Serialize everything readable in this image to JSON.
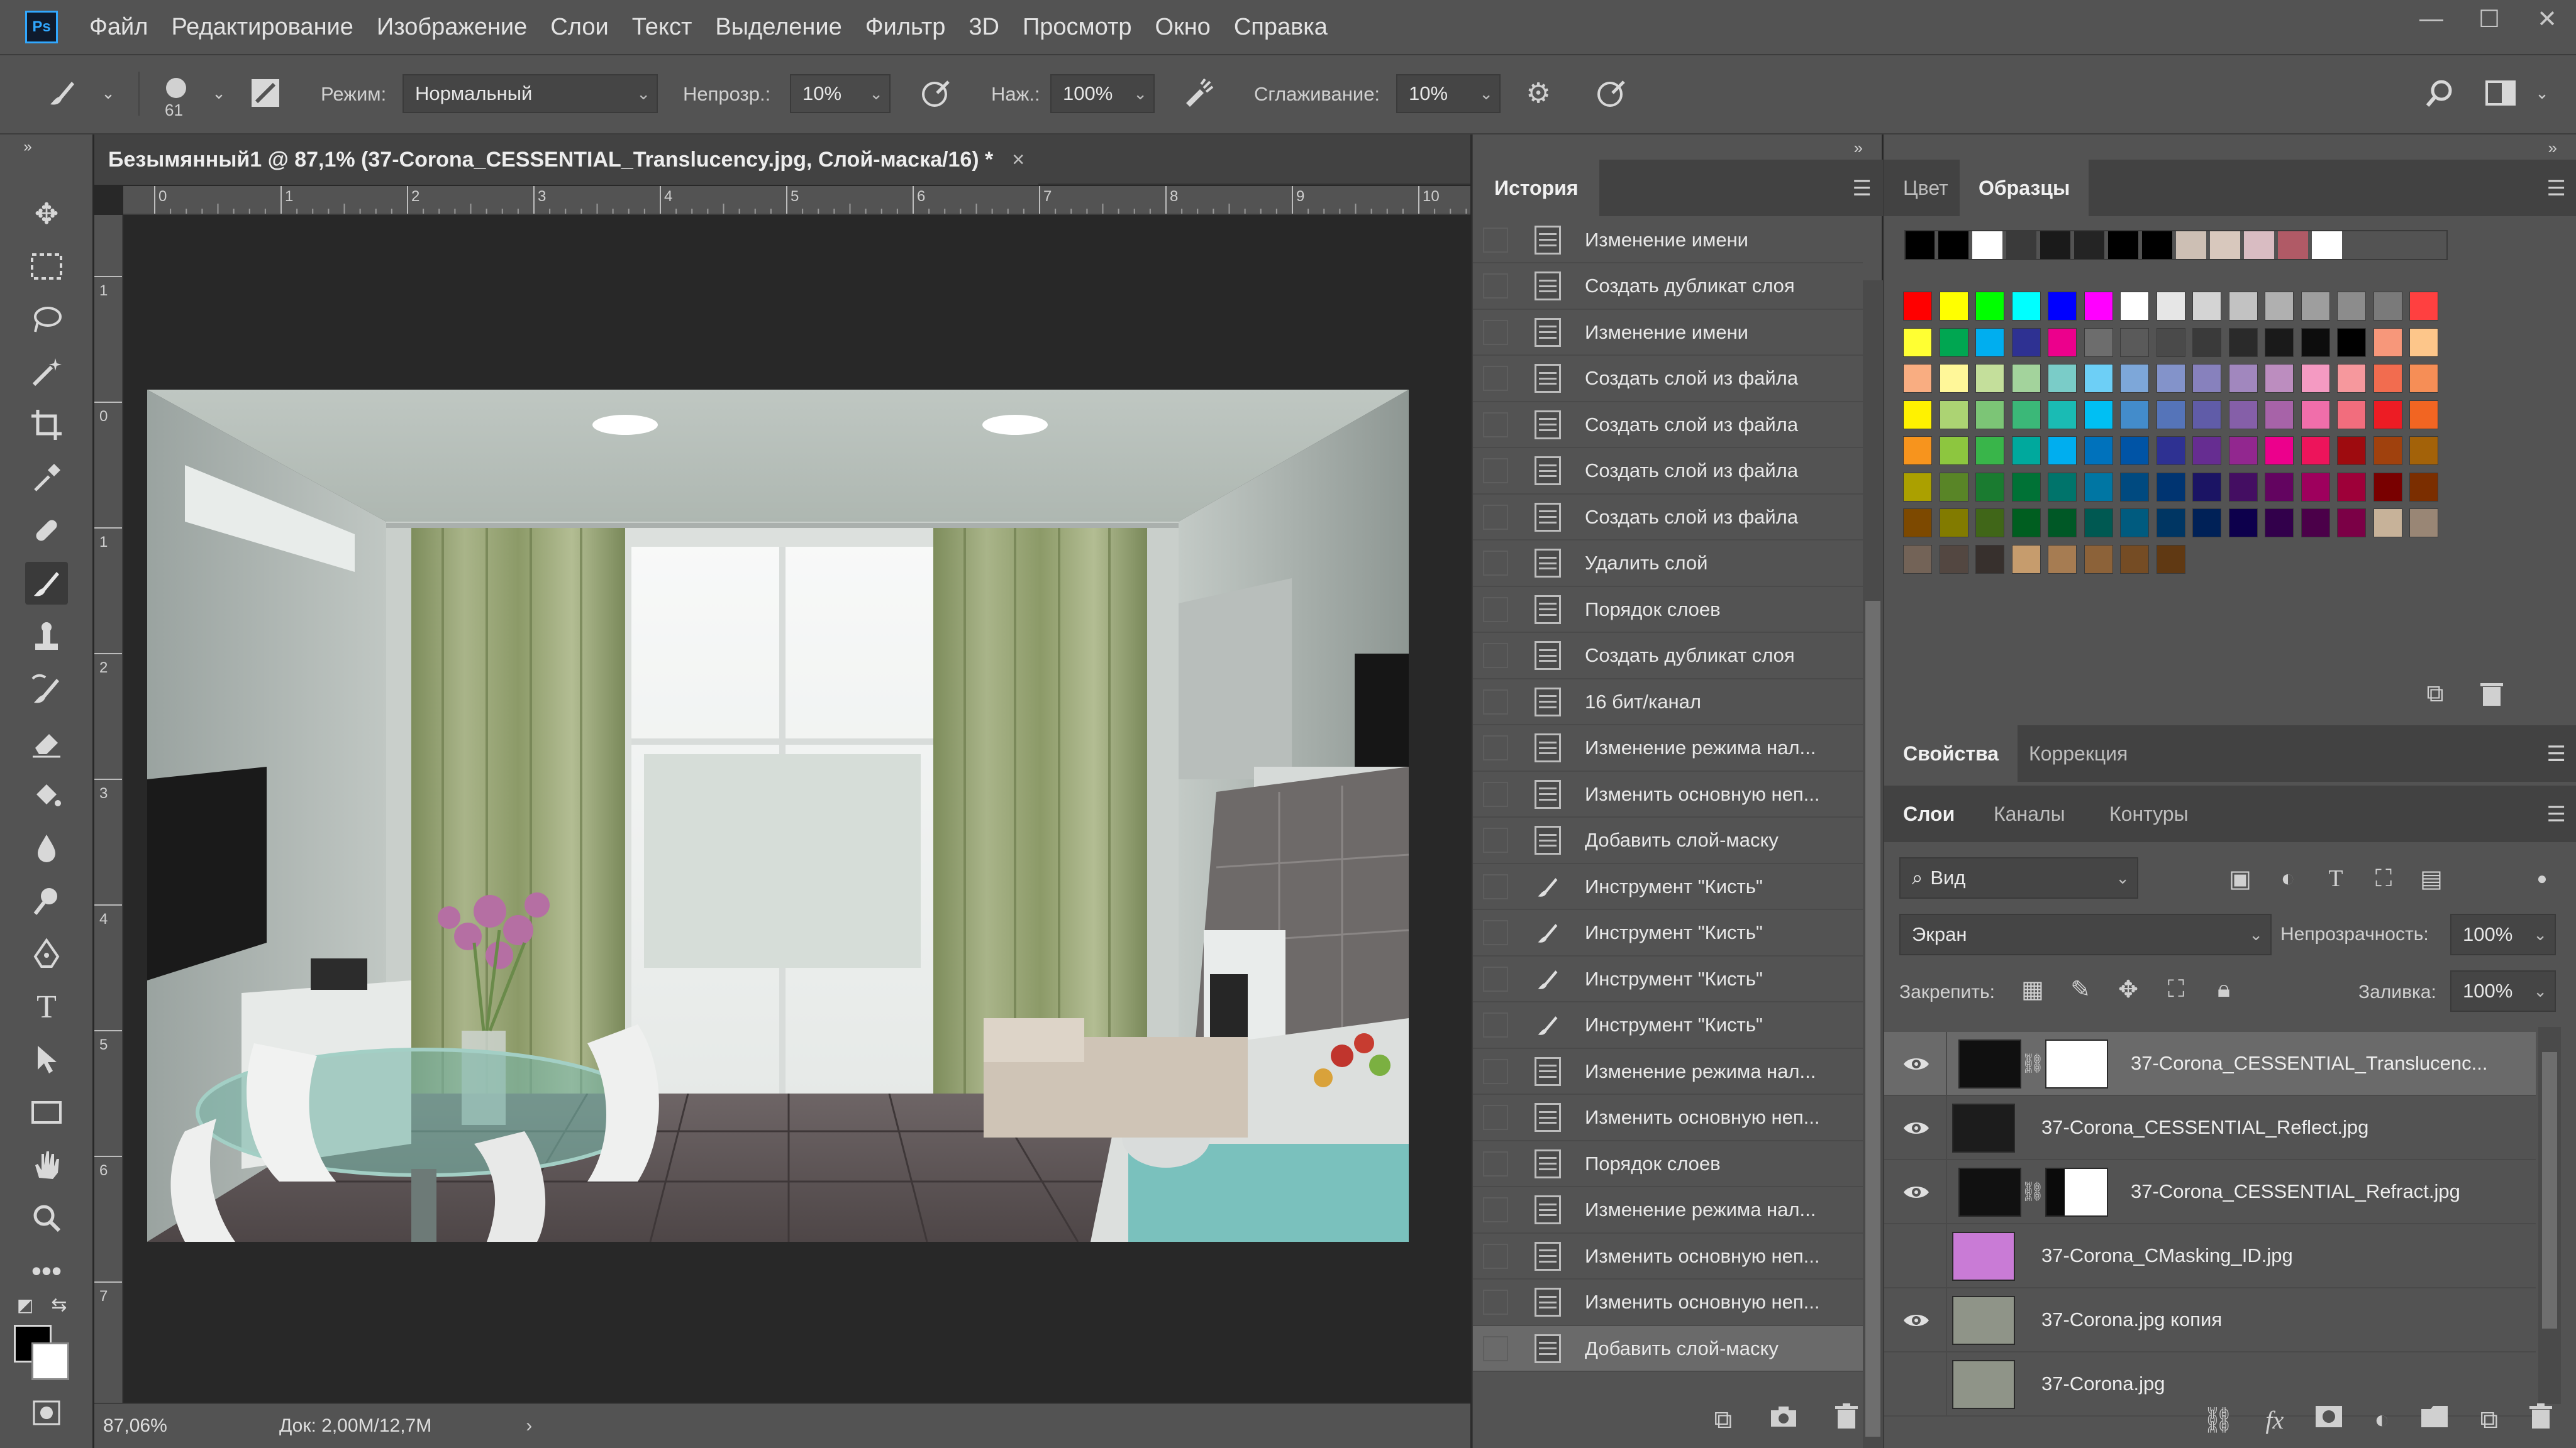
{
  "app": {
    "logo": "Ps"
  },
  "menu": [
    "Файл",
    "Редактирование",
    "Изображение",
    "Слои",
    "Текст",
    "Выделение",
    "Фильтр",
    "3D",
    "Просмотр",
    "Окно",
    "Справка"
  ],
  "window_controls": {
    "minimize": "—",
    "maximize": "☐",
    "close": "✕"
  },
  "options": {
    "brush_size": "61",
    "mode_label": "Режим:",
    "mode_value": "Нормальный",
    "opacity_label": "Непрозр.:",
    "opacity_value": "10%",
    "flow_label": "Наж.:",
    "flow_value": "100%",
    "smoothing_label": "Сглаживание:",
    "smoothing_value": "10%"
  },
  "document": {
    "tab_title": "Безымянный1 @ 87,1% (37-Corona_CESSENTIAL_Translucency.jpg, Слой-маска/16) *",
    "close": "×",
    "ruler_top": [
      "0",
      "1",
      "2",
      "3",
      "4",
      "5",
      "6",
      "7",
      "8",
      "9",
      "10"
    ],
    "ruler_left": [
      "1",
      "0",
      "1",
      "2",
      "3",
      "4",
      "5",
      "6",
      "7"
    ],
    "zoom": "87,06%",
    "doc_size": "Док: 2,00M/12,7M",
    "status_arrow": "›"
  },
  "history": {
    "tab": "История",
    "items": [
      {
        "label": "Изменение имени",
        "icon": "doc-icon"
      },
      {
        "label": "Создать дубликат слоя",
        "icon": "doc-icon"
      },
      {
        "label": "Изменение имени",
        "icon": "doc-icon"
      },
      {
        "label": "Создать слой из файла",
        "icon": "doc-icon"
      },
      {
        "label": "Создать слой из файла",
        "icon": "doc-icon"
      },
      {
        "label": "Создать слой из файла",
        "icon": "doc-icon"
      },
      {
        "label": "Создать слой из файла",
        "icon": "doc-icon"
      },
      {
        "label": "Удалить слой",
        "icon": "doc-icon"
      },
      {
        "label": "Порядок слоев",
        "icon": "doc-icon"
      },
      {
        "label": "Создать дубликат слоя",
        "icon": "doc-icon"
      },
      {
        "label": "16 бит/канал",
        "icon": "doc-icon"
      },
      {
        "label": "Изменение режима нал...",
        "icon": "doc-icon"
      },
      {
        "label": "Изменить основную неп...",
        "icon": "doc-icon"
      },
      {
        "label": "Добавить слой-маску",
        "icon": "doc-icon"
      },
      {
        "label": "Инструмент \"Кисть\"",
        "icon": "brush-icon"
      },
      {
        "label": "Инструмент \"Кисть\"",
        "icon": "brush-icon"
      },
      {
        "label": "Инструмент \"Кисть\"",
        "icon": "brush-icon"
      },
      {
        "label": "Инструмент \"Кисть\"",
        "icon": "brush-icon"
      },
      {
        "label": "Изменение режима нал...",
        "icon": "doc-icon"
      },
      {
        "label": "Изменить основную неп...",
        "icon": "doc-icon"
      },
      {
        "label": "Порядок слоев",
        "icon": "doc-icon"
      },
      {
        "label": "Изменение режима нал...",
        "icon": "doc-icon"
      },
      {
        "label": "Изменить основную неп...",
        "icon": "doc-icon"
      },
      {
        "label": "Изменить основную неп...",
        "icon": "doc-icon"
      },
      {
        "label": "Добавить слой-маску",
        "icon": "doc-icon",
        "active": true
      }
    ]
  },
  "swatches_panel": {
    "tab_color": "Цвет",
    "tab_swatches": "Образцы",
    "recent": [
      "#000000",
      "#000000",
      "#ffffff",
      "#3a3a3a",
      "#1a1a1a",
      "#242424",
      "#000000",
      "#000000",
      "#cdbfb4",
      "#d8c8bd",
      "#d9bcc2",
      "#b05a66",
      "#ffffff"
    ],
    "grid": [
      [
        "#ff0000",
        "#ffff00",
        "#00ff00",
        "#00ffff",
        "#0000ff",
        "#ff00ff",
        "#ffffff",
        "#e6e6e6",
        "#d4d4d4",
        "#c2c2c2",
        "#b0b0b0",
        "#9e9e9e",
        "#8c8c8c",
        "#7a7a7a",
        "#ff4040"
      ],
      [
        "#ffff33",
        "#00a651",
        "#00aeef",
        "#2e3192",
        "#ec008c",
        "#6d6d6d",
        "#5a5a5a",
        "#4a4a4a",
        "#3a3a3a",
        "#2a2a2a",
        "#1a1a1a",
        "#0d0d0d",
        "#000000",
        "#f7977a",
        "#fdc68a"
      ],
      [
        "#f9ad81",
        "#fff799",
        "#c4df9b",
        "#a3d39c",
        "#7accc8",
        "#6dcff6",
        "#7da7d9",
        "#8393ca",
        "#8781bd",
        "#a187be",
        "#bc8dbf",
        "#f49ac2",
        "#f6989d",
        "#f26c4f",
        "#f68e56"
      ],
      [
        "#fff200",
        "#acd373",
        "#7cc576",
        "#3bb878",
        "#1abbb4",
        "#00bff3",
        "#438ccb",
        "#5574b9",
        "#605ca8",
        "#855fa8",
        "#a763a8",
        "#f06eaa",
        "#f26d7d",
        "#ed1c24",
        "#f26522"
      ],
      [
        "#f7941d",
        "#8dc63f",
        "#39b54a",
        "#00a99d",
        "#00aeef",
        "#0072bc",
        "#0054a6",
        "#2e3192",
        "#662d91",
        "#92278f",
        "#ec008c",
        "#ed145b",
        "#9e0b0f",
        "#a0410d",
        "#a36209"
      ],
      [
        "#aba000",
        "#598527",
        "#1a7b30",
        "#007236",
        "#00746b",
        "#0076a3",
        "#004a80",
        "#003471",
        "#1b1464",
        "#440e62",
        "#630460",
        "#9e005d",
        "#9e0039",
        "#790000",
        "#7b2e00"
      ],
      [
        "#7d4900",
        "#827b00",
        "#406618",
        "#005e20",
        "#005826",
        "#005952",
        "#005b7f",
        "#003663",
        "#002157",
        "#0d004c",
        "#32004b",
        "#4b0049",
        "#7b0046",
        "#c7b299",
        "#998675"
      ],
      [
        "#736357",
        "#534741",
        "#37302d",
        "#c69c6d",
        "#a67c52",
        "#8c6239",
        "#754c24",
        "#603913"
      ]
    ]
  },
  "properties_tabs": {
    "properties": "Свойства",
    "adjustments": "Коррекция"
  },
  "layers_panel": {
    "tab_layers": "Слои",
    "tab_channels": "Каналы",
    "tab_paths": "Контуры",
    "filter_kind": "Вид",
    "blend_mode": "Экран",
    "opacity_label": "Непрозрачность:",
    "opacity_value": "100%",
    "lock_label": "Закрепить:",
    "fill_label": "Заливка:",
    "fill_value": "100%",
    "layers": [
      {
        "name": "37-Corona_CESSENTIAL_Translucenc...",
        "visible": true,
        "mask": true,
        "selected": true,
        "thumb": "#101010"
      },
      {
        "name": "37-Corona_CESSENTIAL_Reflect.jpg",
        "visible": true,
        "mask": false,
        "selected": false,
        "thumb": "#1c1c1c"
      },
      {
        "name": "37-Corona_CESSENTIAL_Refract.jpg",
        "visible": true,
        "mask": true,
        "selected": false,
        "thumb": "#111111"
      },
      {
        "name": "37-Corona_CMasking_ID.jpg",
        "visible": false,
        "mask": false,
        "selected": false,
        "thumb": "#c97bd6"
      },
      {
        "name": "37-Corona.jpg копия",
        "visible": true,
        "mask": false,
        "selected": false,
        "thumb": "#8f9488"
      },
      {
        "name": "37-Corona.jpg",
        "visible": false,
        "mask": false,
        "selected": false,
        "thumb": "#8f9488"
      }
    ]
  },
  "icons": {
    "eye": "👁",
    "chain": "⛓"
  }
}
